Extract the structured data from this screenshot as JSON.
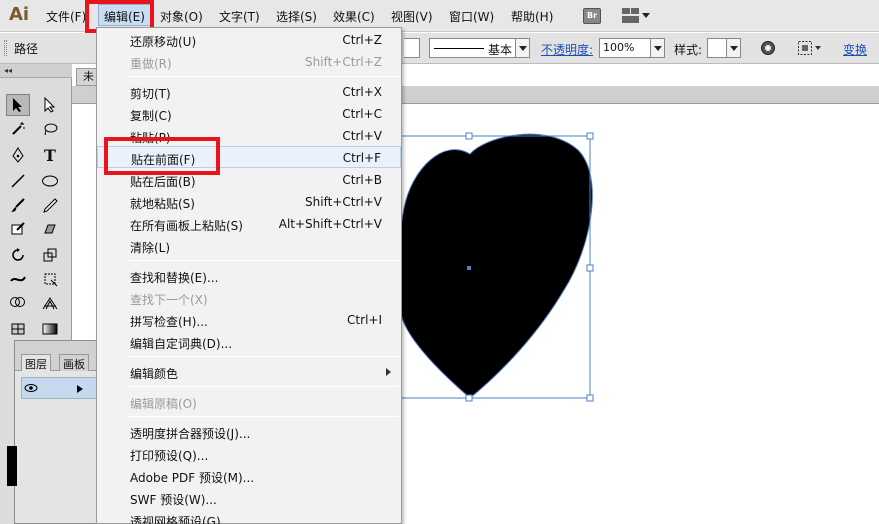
{
  "app": {
    "logo": "Ai"
  },
  "menubar": {
    "items": [
      {
        "id": "file",
        "label": "文件(F)"
      },
      {
        "id": "edit",
        "label": "编辑(E)"
      },
      {
        "id": "object",
        "label": "对象(O)"
      },
      {
        "id": "type",
        "label": "文字(T)"
      },
      {
        "id": "select",
        "label": "选择(S)"
      },
      {
        "id": "effect",
        "label": "效果(C)"
      },
      {
        "id": "view",
        "label": "视图(V)"
      },
      {
        "id": "window",
        "label": "窗口(W)"
      },
      {
        "id": "help",
        "label": "帮助(H)"
      }
    ],
    "bridge_label": "Br"
  },
  "controlbar": {
    "selection_label": "路径",
    "stroke_profile": "基本",
    "opacity_label": "不透明度:",
    "opacity_value": "100%",
    "style_label": "样式:",
    "transform_label": "变换"
  },
  "document": {
    "tab_label": "未"
  },
  "layers_panel": {
    "tabs": [
      "图层",
      "画板"
    ]
  },
  "edit_menu": {
    "items": [
      {
        "label": "还原移动(U)",
        "shortcut": "Ctrl+Z",
        "enabled": true
      },
      {
        "label": "重做(R)",
        "shortcut": "Shift+Ctrl+Z",
        "enabled": false
      },
      {
        "label": "剪切(T)",
        "shortcut": "Ctrl+X",
        "enabled": true
      },
      {
        "label": "复制(C)",
        "shortcut": "Ctrl+C",
        "enabled": true
      },
      {
        "label": "粘贴(P)",
        "shortcut": "Ctrl+V",
        "enabled": true
      },
      {
        "label": "贴在前面(F)",
        "shortcut": "Ctrl+F",
        "enabled": true,
        "highlighted": true
      },
      {
        "label": "贴在后面(B)",
        "shortcut": "Ctrl+B",
        "enabled": true
      },
      {
        "label": "就地粘贴(S)",
        "shortcut": "Shift+Ctrl+V",
        "enabled": true
      },
      {
        "label": "在所有画板上粘贴(S)",
        "shortcut": "Alt+Shift+Ctrl+V",
        "enabled": true
      },
      {
        "label": "清除(L)",
        "shortcut": "",
        "enabled": true
      },
      {
        "label": "查找和替换(E)...",
        "shortcut": "",
        "enabled": true
      },
      {
        "label": "查找下一个(X)",
        "shortcut": "",
        "enabled": false
      },
      {
        "label": "拼写检查(H)...",
        "shortcut": "Ctrl+I",
        "enabled": true
      },
      {
        "label": "编辑自定词典(D)...",
        "shortcut": "",
        "enabled": true
      },
      {
        "label": "编辑颜色",
        "shortcut": "",
        "enabled": true,
        "submenu": true
      },
      {
        "label": "编辑原稿(O)",
        "shortcut": "",
        "enabled": false
      },
      {
        "label": "透明度拼合器预设(J)...",
        "shortcut": "",
        "enabled": true
      },
      {
        "label": "打印预设(Q)...",
        "shortcut": "",
        "enabled": true
      },
      {
        "label": "Adobe PDF 预设(M)...",
        "shortcut": "",
        "enabled": true
      },
      {
        "label": "SWF 预设(W)...",
        "shortcut": "",
        "enabled": true
      },
      {
        "label": "透视网格预设(G)...",
        "shortcut": "",
        "enabled": true
      }
    ]
  },
  "colors": {
    "highlight_red": "#e8131b",
    "selection_blue": "#4f7fc9",
    "heart_fill": "#000000"
  }
}
